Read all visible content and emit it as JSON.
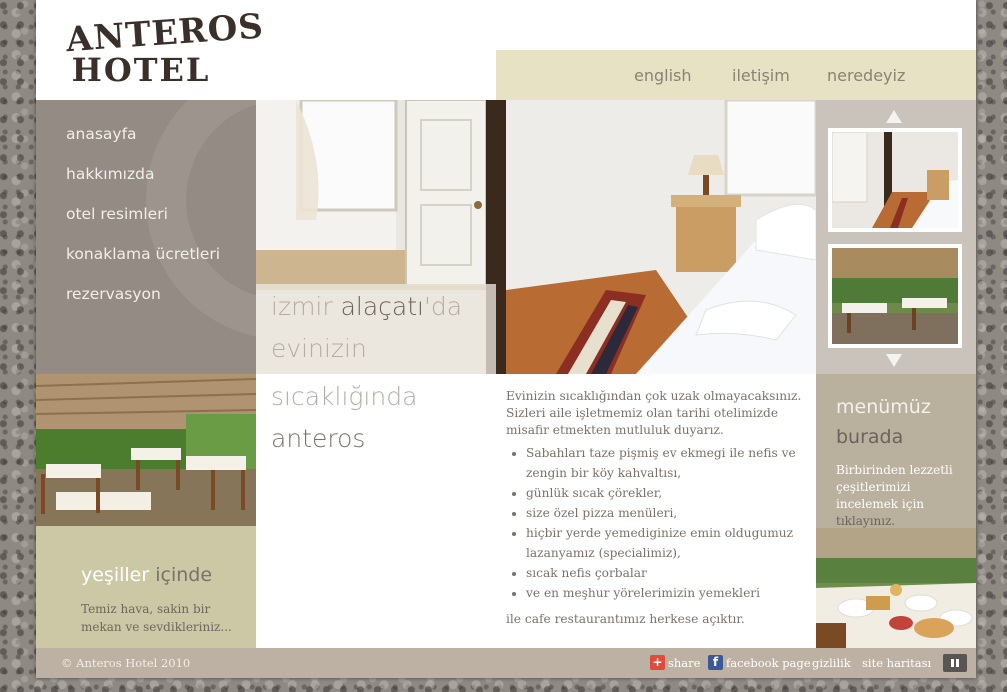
{
  "brand": {
    "line1": "ANTEROS",
    "line2": "HOTEL"
  },
  "topnav": [
    "english",
    "iletişim",
    "neredeyiz"
  ],
  "leftmenu": [
    "anasayfa",
    "hakkımızda",
    "otel resimleri",
    "konaklama ücretleri",
    "rezervasyon"
  ],
  "headline": {
    "part1": "izmir ",
    "part2": "alaçatı",
    "part3": "'da",
    "line2": "evinizin",
    "line3": "sıcaklığında",
    "line4": "anteros"
  },
  "left_box": {
    "title1": "yeşiller ",
    "title2": "içinde",
    "text": "Temiz hava, sakin bir mekan ve sevdikleriniz..."
  },
  "content": {
    "intro": "Evinizin sıcaklığından çok uzak olmayacaksınız. Sizleri aile işletmemiz olan tarihi otelimizde misafir etmekten mutluluk duyarız.",
    "items": [
      "Sabahları taze pişmiş ev ekmegi ile nefis ve zengin bir köy kahvaltısı,",
      "günlük sıcak çörekler,",
      "size özel pizza menüleri,",
      "hiçbir yerde yemediginize emin oldugumuz lazanyamız (specialimiz),",
      "sıcak nefis çorbalar",
      "ve en meşhur yörelerimizin yemekleri"
    ],
    "outro": "ile cafe restaurantımız herkese açıktır."
  },
  "menu_box": {
    "title1": "menümüz",
    "title2": "burada",
    "text": "Birbirinden lezzetli çeşitlerimizi incelemek için ",
    "link": "tıklayınız."
  },
  "footer": {
    "copyright": "© Anteros Hotel 2010",
    "share": "share",
    "facebook": "facebook page",
    "privacy": "gizlilik",
    "sitemap": "site haritası"
  },
  "colors": {
    "nav_bg": "#e6e2c3",
    "menu_bg": "#948b84",
    "green_box": "#ccc7a4",
    "menu_box": "#b9b09e",
    "footer_bg": "#bdb1a3",
    "share_icon": "#e14b3b",
    "facebook_icon": "#3b5998"
  },
  "icons": [
    "plus-share-icon",
    "facebook-icon",
    "pause-icon",
    "arrow-up-icon",
    "arrow-down-icon"
  ]
}
